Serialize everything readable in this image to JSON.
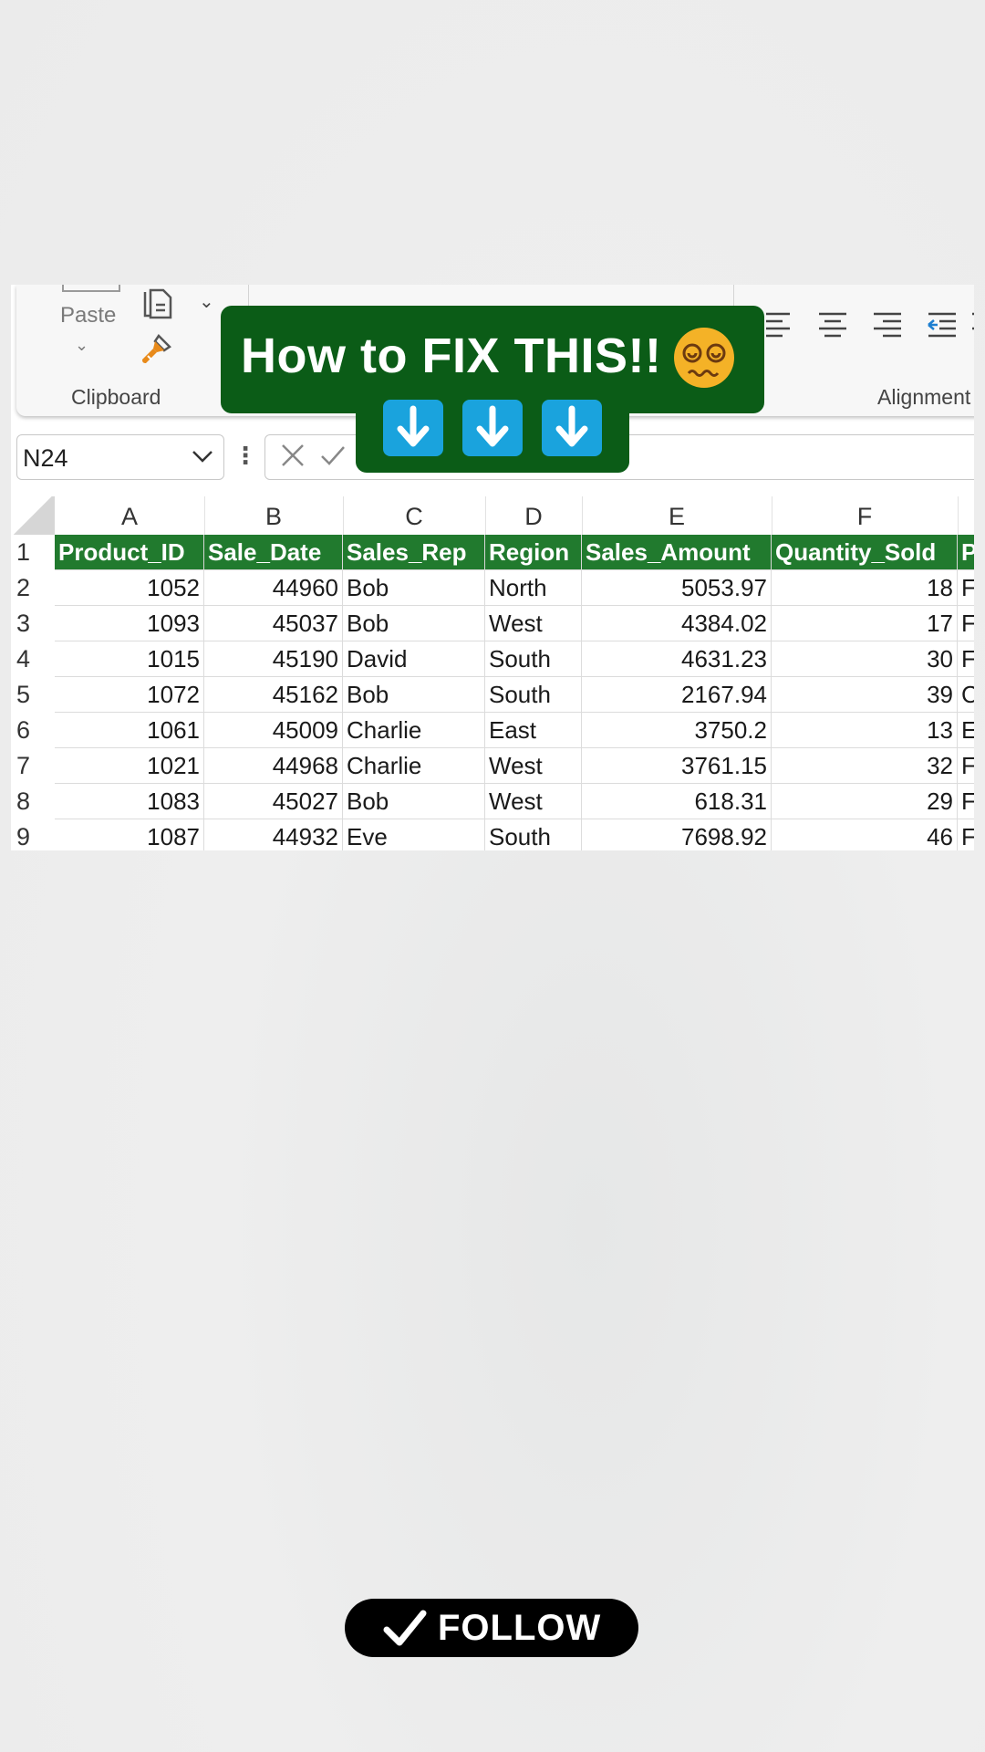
{
  "ribbon": {
    "paste_label": "Paste",
    "clipboard_label": "Clipboard",
    "alignment_label": "Alignment"
  },
  "formula_bar": {
    "name_box": "N24"
  },
  "overlay": {
    "headline": "How to FIX THIS!!",
    "emoji": "dizzy-face-icon",
    "arrow_count": 3
  },
  "sheet": {
    "columns": [
      "A",
      "B",
      "C",
      "D",
      "E",
      "F"
    ],
    "header": [
      "Product_ID",
      "Sale_Date",
      "Sales_Rep",
      "Region",
      "Sales_Amount",
      "Quantity_Sold",
      "P"
    ],
    "rows": [
      {
        "n": "2",
        "cells": [
          "1052",
          "44960",
          "Bob",
          "North",
          "5053.97",
          "18",
          "F"
        ]
      },
      {
        "n": "3",
        "cells": [
          "1093",
          "45037",
          "Bob",
          "West",
          "4384.02",
          "17",
          "F"
        ]
      },
      {
        "n": "4",
        "cells": [
          "1015",
          "45190",
          "David",
          "South",
          "4631.23",
          "30",
          "F"
        ]
      },
      {
        "n": "5",
        "cells": [
          "1072",
          "45162",
          "Bob",
          "South",
          "2167.94",
          "39",
          "C"
        ]
      },
      {
        "n": "6",
        "cells": [
          "1061",
          "45009",
          "Charlie",
          "East",
          "3750.2",
          "13",
          "E"
        ]
      },
      {
        "n": "7",
        "cells": [
          "1021",
          "44968",
          "Charlie",
          "West",
          "3761.15",
          "32",
          "F"
        ]
      },
      {
        "n": "8",
        "cells": [
          "1083",
          "45027",
          "Bob",
          "West",
          "618.31",
          "29",
          "F"
        ]
      },
      {
        "n": "9",
        "cells": [
          "1087",
          "44932",
          "Eve",
          "South",
          "7698.92",
          "46",
          "F"
        ]
      }
    ]
  },
  "follow": {
    "label": "FOLLOW"
  },
  "colors": {
    "header_green": "#217a2e",
    "banner_green": "#0b5c17",
    "arrow_blue": "#1aa3dd"
  }
}
